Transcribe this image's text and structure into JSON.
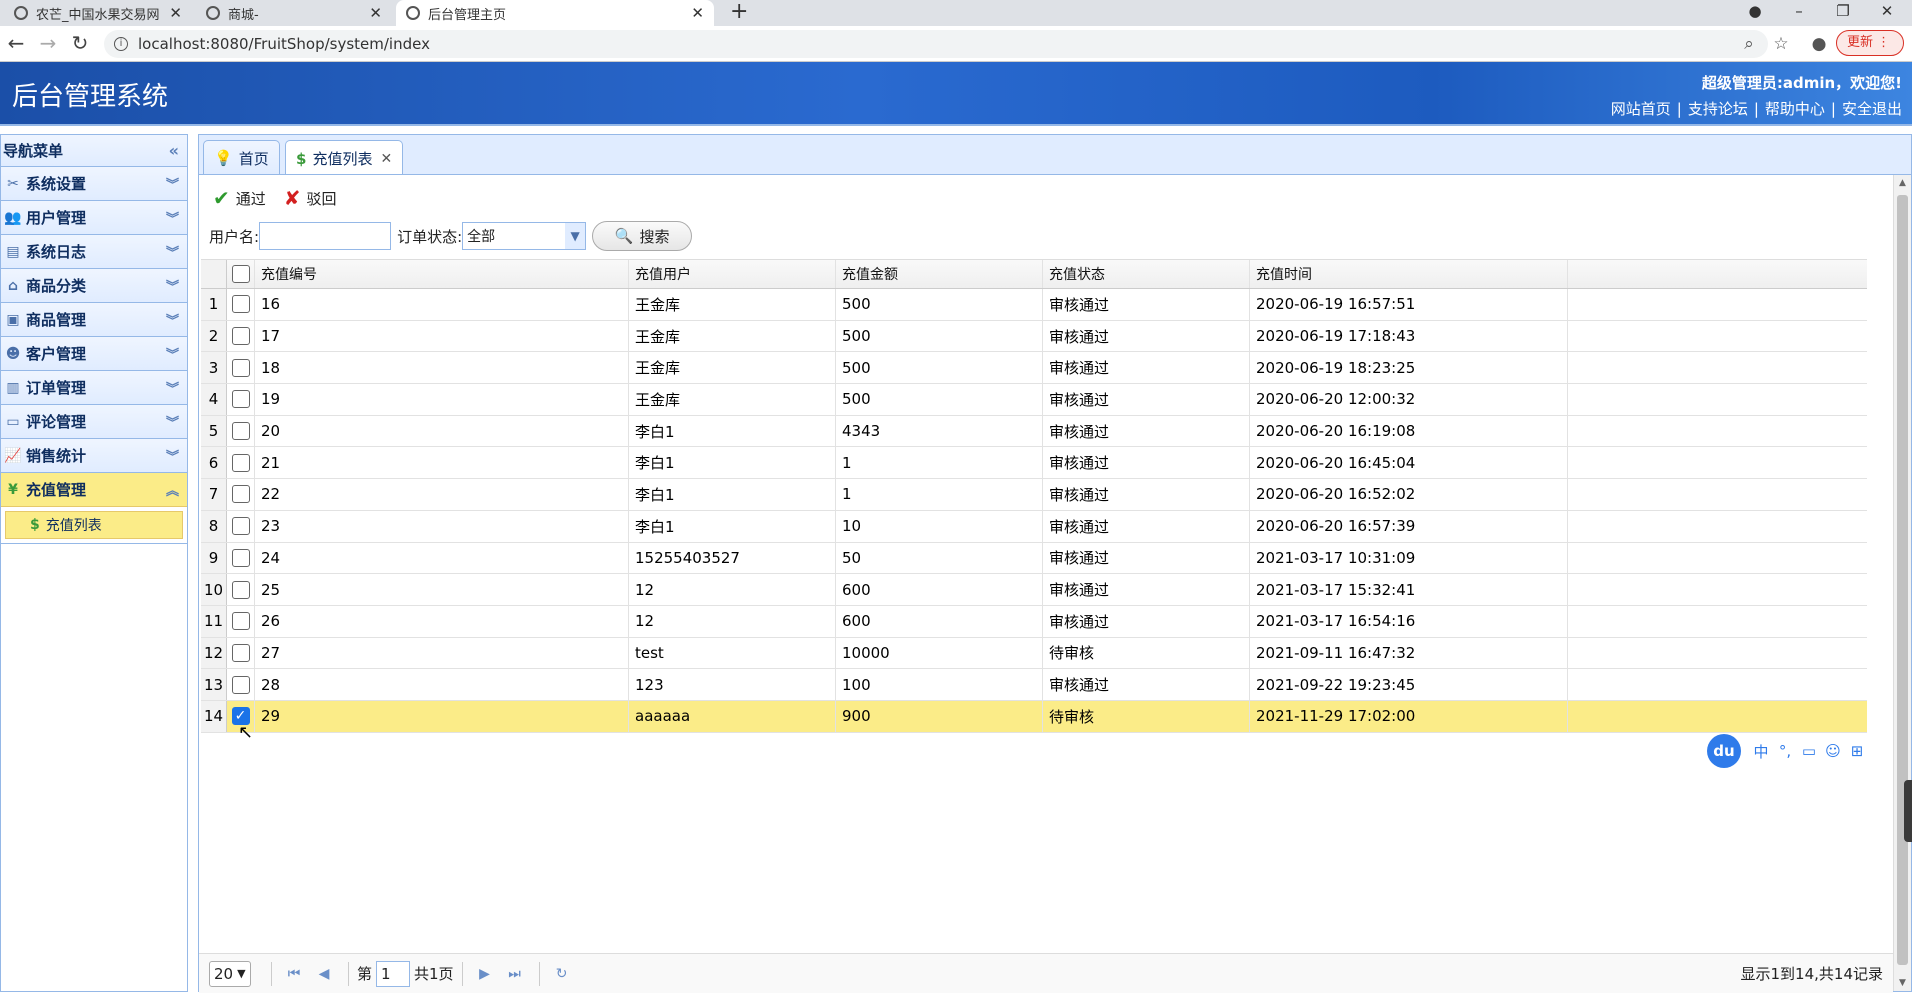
{
  "browser": {
    "tabs": [
      {
        "label": "农芒_中国水果交易网"
      },
      {
        "label": "商城-"
      },
      {
        "label": "后台管理主页"
      }
    ],
    "url": "localhost:8080/FruitShop/system/index",
    "update_label": "更新"
  },
  "header": {
    "title": "后台管理系统",
    "welcome": "超级管理员:admin，欢迎您!",
    "links": [
      "网站首页",
      "支持论坛",
      "帮助中心",
      "安全退出"
    ]
  },
  "sidebar": {
    "title": "导航菜单",
    "items": [
      {
        "label": "系统设置",
        "icon": "tools-icon"
      },
      {
        "label": "用户管理",
        "icon": "users-icon"
      },
      {
        "label": "系统日志",
        "icon": "log-icon"
      },
      {
        "label": "商品分类",
        "icon": "category-icon"
      },
      {
        "label": "商品管理",
        "icon": "goods-icon"
      },
      {
        "label": "客户管理",
        "icon": "customer-icon"
      },
      {
        "label": "订单管理",
        "icon": "order-icon"
      },
      {
        "label": "评论管理",
        "icon": "comment-icon"
      },
      {
        "label": "销售统计",
        "icon": "chart-icon"
      },
      {
        "label": "充值管理",
        "icon": "yen-icon"
      }
    ],
    "subitem": "充值列表"
  },
  "panel_tabs": [
    {
      "label": "首页"
    },
    {
      "label": "充值列表"
    }
  ],
  "toolbar": {
    "approve": "通过",
    "reject": "驳回"
  },
  "filter": {
    "username_label": "用户名:",
    "username_value": "",
    "status_label": "订单状态:",
    "status_value": "全部",
    "search_label": "搜索"
  },
  "grid": {
    "columns": [
      "充值编号",
      "充值用户",
      "充值金额",
      "充值状态",
      "充值时间"
    ],
    "rows": [
      {
        "n": "1",
        "id": "16",
        "user": "王金库",
        "amount": "500",
        "status": "审核通过",
        "time": "2020-06-19 16:57:51"
      },
      {
        "n": "2",
        "id": "17",
        "user": "王金库",
        "amount": "500",
        "status": "审核通过",
        "time": "2020-06-19 17:18:43"
      },
      {
        "n": "3",
        "id": "18",
        "user": "王金库",
        "amount": "500",
        "status": "审核通过",
        "time": "2020-06-19 18:23:25"
      },
      {
        "n": "4",
        "id": "19",
        "user": "王金库",
        "amount": "500",
        "status": "审核通过",
        "time": "2020-06-20 12:00:32"
      },
      {
        "n": "5",
        "id": "20",
        "user": "李白1",
        "amount": "4343",
        "status": "审核通过",
        "time": "2020-06-20 16:19:08"
      },
      {
        "n": "6",
        "id": "21",
        "user": "李白1",
        "amount": "1",
        "status": "审核通过",
        "time": "2020-06-20 16:45:04"
      },
      {
        "n": "7",
        "id": "22",
        "user": "李白1",
        "amount": "1",
        "status": "审核通过",
        "time": "2020-06-20 16:52:02"
      },
      {
        "n": "8",
        "id": "23",
        "user": "李白1",
        "amount": "10",
        "status": "审核通过",
        "time": "2020-06-20 16:57:39"
      },
      {
        "n": "9",
        "id": "24",
        "user": "15255403527",
        "amount": "50",
        "status": "审核通过",
        "time": "2021-03-17 10:31:09"
      },
      {
        "n": "10",
        "id": "25",
        "user": "12",
        "amount": "600",
        "status": "审核通过",
        "time": "2021-03-17 15:32:41"
      },
      {
        "n": "11",
        "id": "26",
        "user": "12",
        "amount": "600",
        "status": "审核通过",
        "time": "2021-03-17 16:54:16"
      },
      {
        "n": "12",
        "id": "27",
        "user": "test",
        "amount": "10000",
        "status": "待审核",
        "time": "2021-09-11 16:47:32"
      },
      {
        "n": "13",
        "id": "28",
        "user": "123",
        "amount": "100",
        "status": "审核通过",
        "time": "2021-09-22 19:23:45"
      },
      {
        "n": "14",
        "id": "29",
        "user": "aaaaaa",
        "amount": "900",
        "status": "待审核",
        "time": "2021-11-29 17:02:00",
        "selected": true
      }
    ]
  },
  "pager": {
    "page_size": "20",
    "page_prefix": "第",
    "page_value": "1",
    "page_total": "共1页",
    "info": "显示1到14,共14记录"
  },
  "ime": {
    "brand": "du",
    "icons": [
      "中",
      "°,",
      "▭",
      "☺",
      "⊞"
    ]
  },
  "colors": {
    "header": "#2a6ad0",
    "selected_row": "#fbec88",
    "border": "#95b8e7"
  }
}
